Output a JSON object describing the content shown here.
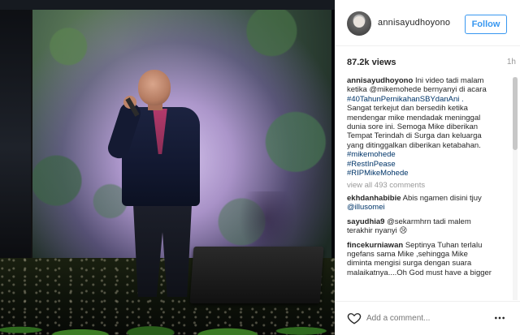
{
  "post": {
    "username": "annisayudhoyono",
    "follow_label": "Follow",
    "views": "87.2k views",
    "time_ago": "1h"
  },
  "caption": {
    "username": "annisayudhoyono",
    "lines": [
      "Ini video tadi malam",
      "ketika @mikemohede bernyanyi di acara",
      "#40TahunPernikahanSBYdanAni .",
      "Sangat terkejut dan bersedih ketika",
      "mendengar mike mendadak meninggal",
      "dunia sore ini. Semoga Mike diberikan",
      "Tempat Terindah di Surga dan keluarga",
      "yang ditinggalkan diberikan ketabahan."
    ],
    "tags": [
      "#mikemohede",
      "#RestInPease",
      "#RIPMikeMohede"
    ]
  },
  "view_all_label": "view all 493 comments",
  "comments": [
    {
      "username": "ekhdanhabibie",
      "lines": [
        "Abis ngamen disini tjuy",
        "@illusomei"
      ]
    },
    {
      "username": "sayudhia9",
      "lines": [
        "@sekarmhrn tadi malem",
        "terakhir nyanyi 😢"
      ]
    },
    {
      "username": "fincekurniawan",
      "lines": [
        "Septinya Tuhan terlalu",
        "ngefans sama Mike ,sehingga Mike",
        "diminta mengisi surga dengan suara",
        "malaikatnya....Oh God must have a bigger"
      ]
    }
  ],
  "footer": {
    "add_comment_placeholder": "Add a comment...",
    "icons": [
      "heart-icon",
      "more-options-icon"
    ]
  },
  "colors": {
    "link": "#003569",
    "follow": "#3897f0",
    "muted": "#999999"
  }
}
